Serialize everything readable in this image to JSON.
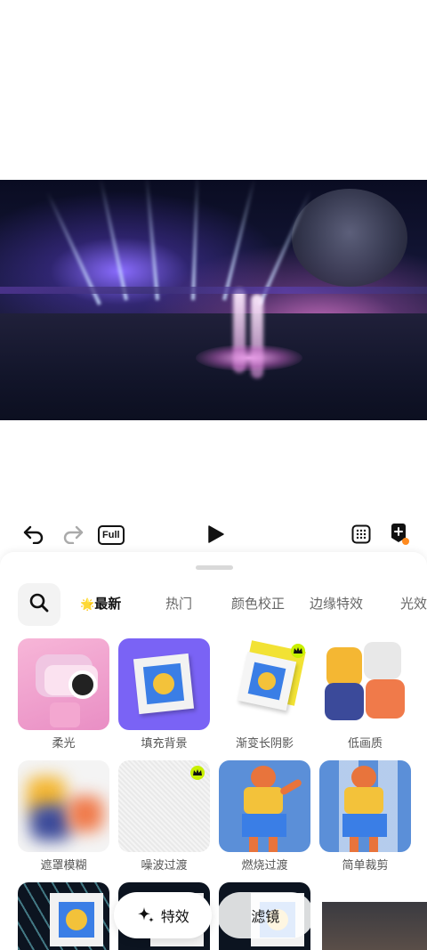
{
  "toolbar": {
    "undo_icon": "undo-icon",
    "redo_icon": "redo-icon",
    "full_label": "Full",
    "play_icon": "play-icon",
    "grid_icon": "grid-icon",
    "add_sticker_icon": "add-sticker-icon",
    "badge_color": "#ff8a1f"
  },
  "panel": {
    "search_icon": "search-icon",
    "tabs": [
      {
        "label": "最新",
        "emoji": "🌟",
        "active": true
      },
      {
        "label": "热门",
        "active": false
      },
      {
        "label": "颜色校正",
        "active": false
      },
      {
        "label": "边缘特效",
        "active": false
      },
      {
        "label": "光效",
        "active": false
      }
    ],
    "accent": "#c8f000",
    "effects": [
      {
        "label": "柔光",
        "premium": false
      },
      {
        "label": "填充背景",
        "premium": false
      },
      {
        "label": "渐变长阴影",
        "premium": true
      },
      {
        "label": "低画质",
        "premium": false
      },
      {
        "label": "遮罩模糊",
        "premium": false
      },
      {
        "label": "噪波过渡",
        "premium": true
      },
      {
        "label": "燃烧过渡",
        "premium": false
      },
      {
        "label": "简单裁剪",
        "premium": false
      }
    ]
  },
  "bottom_bar": {
    "effects_label": "特效",
    "filter_label": "滤镜",
    "sparkle_icon": "sparkle-icon"
  }
}
